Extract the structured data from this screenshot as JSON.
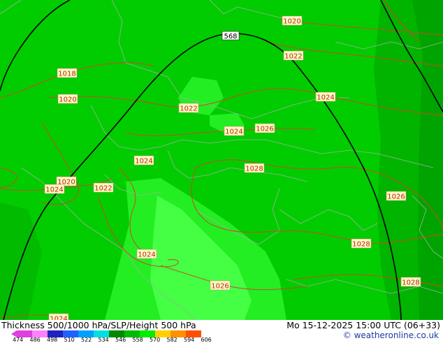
{
  "map": {
    "colors": {
      "base": "#00cc00",
      "light": "#22ee22",
      "lighter": "#44ff44",
      "dark": "#00b400",
      "darker": "#009a00",
      "isobar": "#cc4a22",
      "height_contour": "#000000",
      "border": "#a0b0a0"
    },
    "isobar_labels": [
      {
        "id": "1020-a",
        "text": "1020"
      },
      {
        "id": "1022-a",
        "text": "1022"
      },
      {
        "id": "1018",
        "text": "1018"
      },
      {
        "id": "1020-b",
        "text": "1020"
      },
      {
        "id": "1022-b",
        "text": "1022"
      },
      {
        "id": "1024-a",
        "text": "1024"
      },
      {
        "id": "1024-b",
        "text": "1024"
      },
      {
        "id": "1026-a",
        "text": "1026"
      },
      {
        "id": "1028-a",
        "text": "1028"
      },
      {
        "id": "1024-c",
        "text": "1024"
      },
      {
        "id": "1020-c",
        "text": "1020"
      },
      {
        "id": "1024-d",
        "text": "1024"
      },
      {
        "id": "1022-c",
        "text": "1022"
      },
      {
        "id": "1026-b",
        "text": "1026"
      },
      {
        "id": "1028-b",
        "text": "1028"
      },
      {
        "id": "1024-e",
        "text": "1024"
      },
      {
        "id": "1026-c",
        "text": "1026"
      },
      {
        "id": "1028-c",
        "text": "1028"
      },
      {
        "id": "1024-f",
        "text": "1024"
      }
    ],
    "height_label": "568"
  },
  "footer": {
    "title": "Thickness 500/1000 hPa/SLP/Height 500 hPa",
    "datetime": "Mo 15-12-2025 15:00 UTC (06+33)",
    "credit": "© weatheronline.co.uk",
    "legend": {
      "values": [
        "474",
        "486",
        "498",
        "510",
        "522",
        "534",
        "546",
        "558",
        "570",
        "582",
        "594",
        "606"
      ],
      "colors": [
        "#e040e0",
        "#ff80ff",
        "#2020c0",
        "#2060ff",
        "#00a0ff",
        "#00e0e0",
        "#008800",
        "#00bb00",
        "#00ee00",
        "#ffd000",
        "#ff9000",
        "#ff5000"
      ]
    }
  }
}
